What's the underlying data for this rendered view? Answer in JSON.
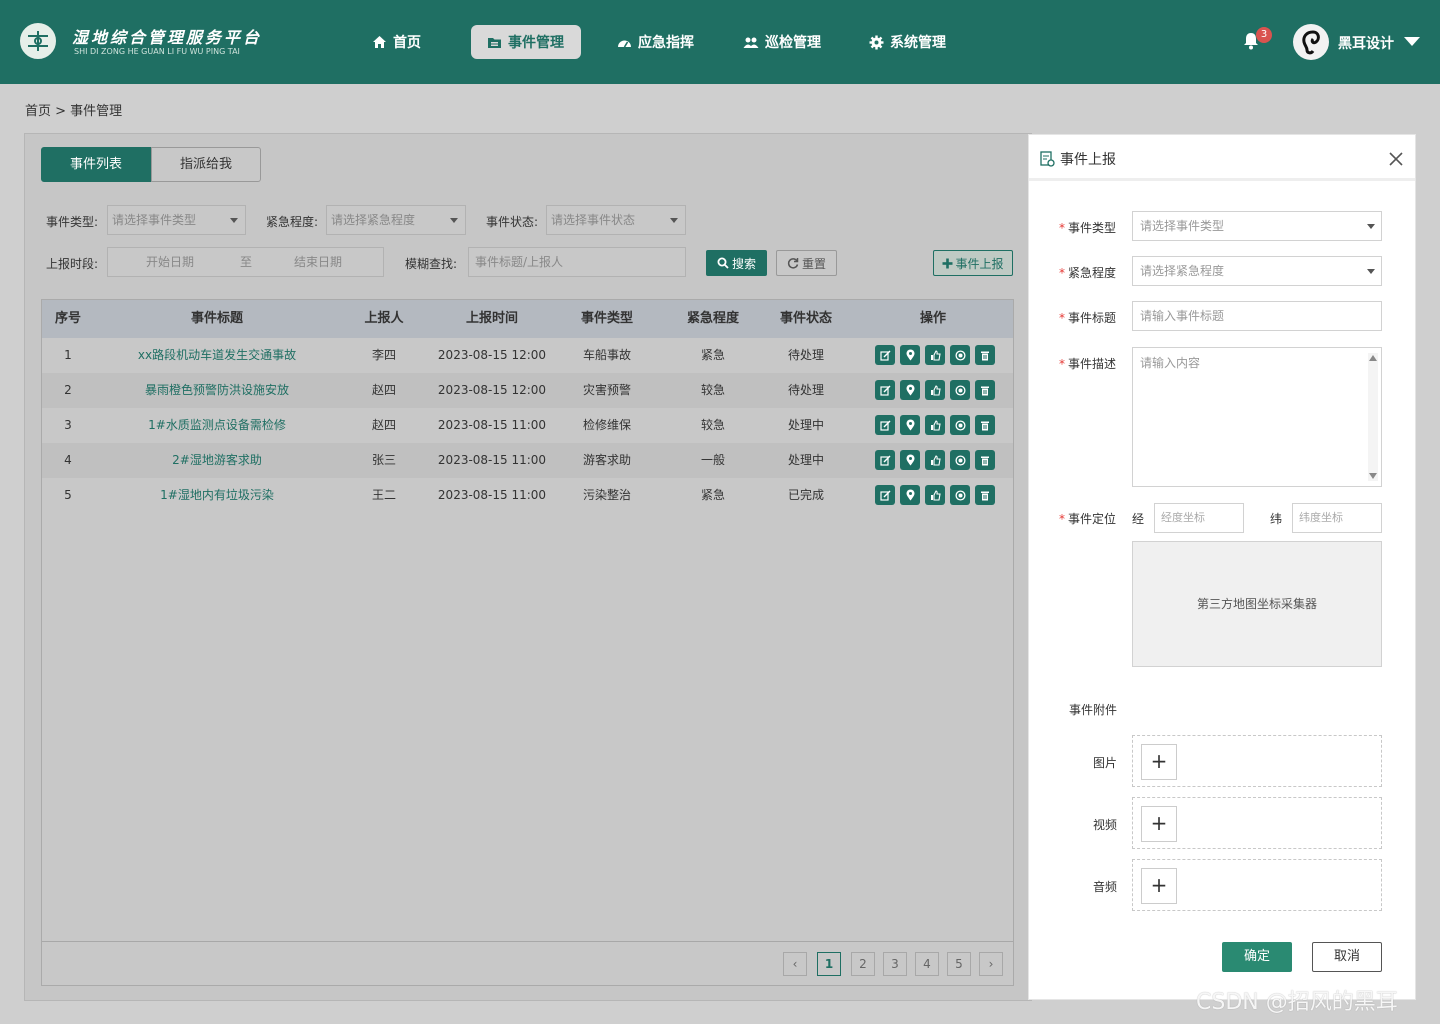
{
  "header": {
    "logo_title": "湿地综合管理服务平台",
    "logo_subtitle": "SHI DI ZONG HE GUAN LI FU WU PING TAI",
    "nav": [
      {
        "label": "首页",
        "icon": "home-icon"
      },
      {
        "label": "事件管理",
        "icon": "folder-icon",
        "active": true
      },
      {
        "label": "应急指挥",
        "icon": "dashboard-icon"
      },
      {
        "label": "巡检管理",
        "icon": "users-icon"
      },
      {
        "label": "系统管理",
        "icon": "gear-icon"
      }
    ],
    "notification_count": "3",
    "user_name": "黑耳设计"
  },
  "breadcrumb": "首页 > 事件管理",
  "tabs": {
    "list": "事件列表",
    "assigned": "指派给我"
  },
  "filters": {
    "type_label": "事件类型:",
    "type_placeholder": "请选择事件类型",
    "urgency_label": "紧急程度:",
    "urgency_placeholder": "请选择紧急程度",
    "status_label": "事件状态:",
    "status_placeholder": "请选择事件状态",
    "period_label": "上报时段:",
    "start_date": "开始日期",
    "to": "至",
    "end_date": "结束日期",
    "fuzzy_label": "模糊查找:",
    "fuzzy_placeholder": "事件标题/上报人",
    "search_btn": "搜索",
    "reset_btn": "重置",
    "report_btn": "事件上报"
  },
  "table": {
    "headers": [
      "序号",
      "事件标题",
      "上报人",
      "上报时间",
      "事件类型",
      "紧急程度",
      "事件状态",
      "操作"
    ],
    "rows": [
      {
        "no": "1",
        "title": "xx路段机动车道发生交通事故",
        "reporter": "李四",
        "time": "2023-08-15 12:00",
        "type": "车船事故",
        "urgency": "紧急",
        "status": "待处理"
      },
      {
        "no": "2",
        "title": "暴雨橙色预警防洪设施安放",
        "reporter": "赵四",
        "time": "2023-08-15 12:00",
        "type": "灾害预警",
        "urgency": "较急",
        "status": "待处理"
      },
      {
        "no": "3",
        "title": "1#水质监测点设备需检修",
        "reporter": "赵四",
        "time": "2023-08-15 11:00",
        "type": "检修维保",
        "urgency": "较急",
        "status": "处理中"
      },
      {
        "no": "4",
        "title": "2#湿地游客求助",
        "reporter": "张三",
        "time": "2023-08-15 11:00",
        "type": "游客求助",
        "urgency": "一般",
        "status": "处理中"
      },
      {
        "no": "5",
        "title": "1#湿地内有垃圾污染",
        "reporter": "王二",
        "time": "2023-08-15 11:00",
        "type": "污染整治",
        "urgency": "紧急",
        "status": "已完成"
      }
    ]
  },
  "pagination": {
    "prev": "‹",
    "pages": [
      "1",
      "2",
      "3",
      "4",
      "5"
    ],
    "current": "1",
    "next": "›"
  },
  "dialog": {
    "title": "事件上报",
    "type_label": "事件类型",
    "type_placeholder": "请选择事件类型",
    "urgency_label": "紧急程度",
    "urgency_placeholder": "请选择紧急程度",
    "title_label": "事件标题",
    "title_placeholder": "请输入事件标题",
    "desc_label": "事件描述",
    "desc_placeholder": "请输入内容",
    "location_label": "事件定位",
    "lng_label": "经",
    "lng_placeholder": "经度坐标",
    "lat_label": "纬",
    "lat_placeholder": "纬度坐标",
    "map_text": "第三方地图坐标采集器",
    "attach_label": "事件附件",
    "image_label": "图片",
    "video_label": "视频",
    "audio_label": "音频",
    "plus": "+",
    "ok": "确定",
    "cancel": "取消"
  },
  "watermark": "CSDN @招风的黑耳",
  "colors": {
    "primary": "#1f6f63",
    "danger": "#e53935"
  }
}
